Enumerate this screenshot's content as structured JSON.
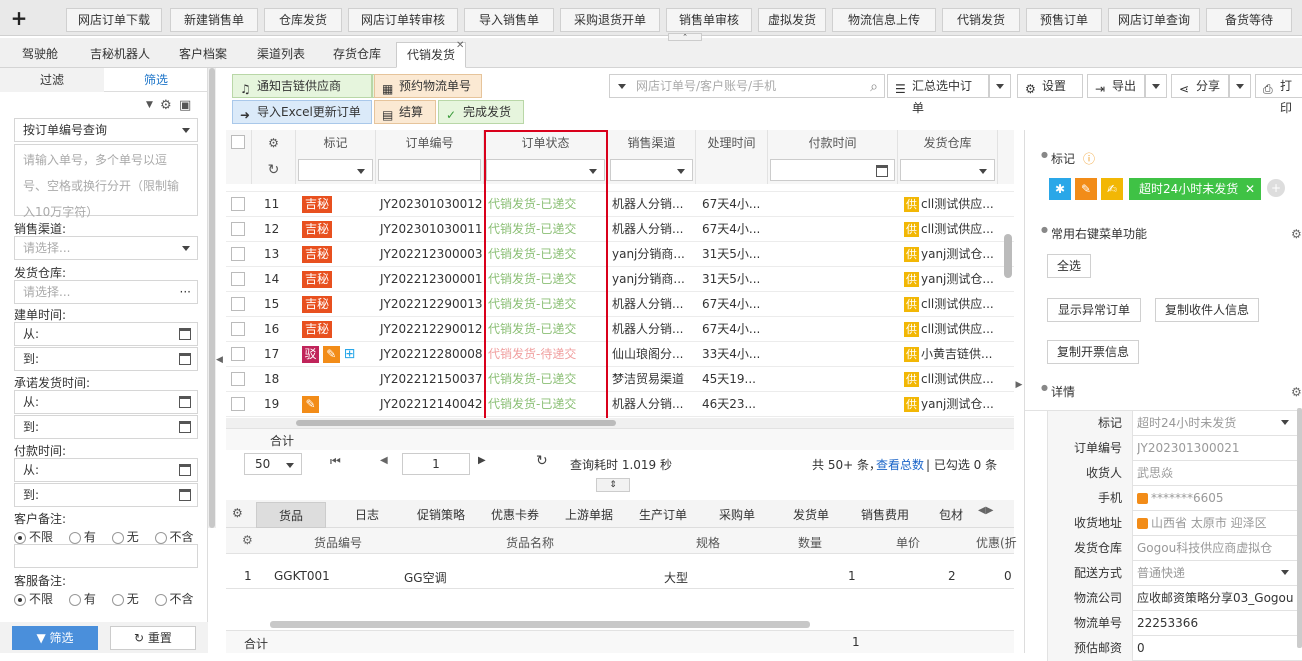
{
  "topnav": {
    "plus": "+",
    "tabs": [
      "网店订单下载",
      "新建销售单",
      "仓库发货",
      "网店订单转审核",
      "导入销售单",
      "采购退货开单",
      "销售单审核",
      "虚拟发货",
      "物流信息上传",
      "代销发货",
      "预售订单",
      "网店订单查询",
      "备货等待"
    ]
  },
  "pagetabs": [
    "驾驶舱",
    "吉秘机器人",
    "客户档案",
    "渠道列表",
    "存货仓库",
    "代销发货"
  ],
  "left": {
    "tab_filter": "过滤",
    "tab_screen": "筛选",
    "query_mode": "按订单编号查询",
    "order_input_ph": "请输入单号，多个单号以逗号、空格或换行分开（限制输入10万字符）",
    "sales_channel_label": "销售渠道:",
    "sales_channel_ph": "请选择...",
    "warehouse_label": "发货仓库:",
    "warehouse_ph": "请选择...",
    "created_label": "建单时间:",
    "from": "从:",
    "to": "到:",
    "promise_label": "承诺发货时间:",
    "pay_label": "付款时间:",
    "cust_note_label": "客户备注:",
    "svc_note_label": "客服备注:",
    "opt_any": "不限",
    "opt_has": "有",
    "opt_none": "无",
    "opt_not": "不含",
    "btn_filter": "筛选",
    "btn_reset": "重置"
  },
  "toolbar": {
    "notify": "通知吉链供应商",
    "reserve": "预约物流单号",
    "import_excel": "导入Excel更新订单",
    "settle": "结算",
    "done": "完成发货",
    "search_ph": "网店订单号/客户账号/手机",
    "summary": "汇总选中订单",
    "settings": "设置",
    "export": "导出",
    "share": "分享",
    "print": "打印"
  },
  "grid": {
    "headers": [
      "标记",
      "订单编号",
      "订单状态",
      "销售渠道",
      "处理时间",
      "付款时间",
      "发货仓库"
    ],
    "rows": [
      {
        "n": "11",
        "tag": "吉秘",
        "order": "JY202301030012",
        "status": "代销发货-已递交",
        "channel": "机器人分销...",
        "time": "67天4小...",
        "wh": "cll测试供应...",
        "gy": "供"
      },
      {
        "n": "12",
        "tag": "吉秘",
        "order": "JY202301030011",
        "status": "代销发货-已递交",
        "channel": "机器人分销...",
        "time": "67天4小...",
        "wh": "cll测试供应...",
        "gy": "供"
      },
      {
        "n": "13",
        "tag": "吉秘",
        "order": "JY202212300003",
        "status": "代销发货-已递交",
        "channel": "yanj分销商...",
        "time": "31天5小...",
        "wh": "yanj测试仓...",
        "gy": "供"
      },
      {
        "n": "14",
        "tag": "吉秘",
        "order": "JY202212300001",
        "status": "代销发货-已递交",
        "channel": "yanj分销商...",
        "time": "31天5小...",
        "wh": "yanj测试仓...",
        "gy": "供"
      },
      {
        "n": "15",
        "tag": "吉秘",
        "order": "JY202212290013",
        "status": "代销发货-已递交",
        "channel": "机器人分销...",
        "time": "67天4小...",
        "wh": "cll测试供应...",
        "gy": "供"
      },
      {
        "n": "16",
        "tag": "吉秘",
        "order": "JY202212290012",
        "status": "代销发货-已递交",
        "channel": "机器人分销...",
        "time": "67天4小...",
        "wh": "cll测试供应...",
        "gy": "供"
      },
      {
        "n": "17",
        "tag": "驳",
        "order": "JY202212280008",
        "status": "代销发货-待递交",
        "channel": "仙山琅阁分...",
        "time": "33天4小...",
        "wh": "小黄吉链供...",
        "gy": "供"
      },
      {
        "n": "18",
        "tag": "",
        "order": "JY202212150037",
        "status": "代销发货-已递交",
        "channel": "梦洁贸易渠道",
        "time": "45天19...",
        "wh": "cll测试供应...",
        "gy": "供"
      },
      {
        "n": "19",
        "tag": "wrench",
        "order": "JY202212140042",
        "status": "代销发货-已递交",
        "channel": "机器人分销...",
        "time": "46天23...",
        "wh": "yanj测试仓...",
        "gy": "供"
      }
    ],
    "total_label": "合计"
  },
  "pager": {
    "page_size": "50",
    "page": "1",
    "query_time": "查询耗时 1.019 秒",
    "total": "共 50+ 条，",
    "view_total": "查看总数",
    "selected": "| 已勾选 0 条"
  },
  "bottom": {
    "tabs": [
      "货品",
      "日志",
      "促销策略",
      "优惠卡券",
      "上游单据",
      "生产订单",
      "采购单",
      "发货单",
      "销售费用",
      "包材"
    ],
    "headers": [
      "货品编号",
      "货品名称",
      "规格",
      "数量",
      "单价",
      "优惠(折"
    ],
    "row": {
      "n": "1",
      "code": "GGKT001",
      "name": "GG空调",
      "spec": "大型",
      "qty": "1",
      "price": "2",
      "disc": "0"
    },
    "total_label": "合计",
    "total_qty": "1"
  },
  "right": {
    "mark_label": "标记",
    "mark_chip": "超时24小时未发货",
    "menu_label": "常用右键菜单功能",
    "btn_select_all": "全选",
    "btn_show_abnormal": "显示异常订单",
    "btn_copy_receiver": "复制收件人信息",
    "btn_copy_invoice": "复制开票信息",
    "detail_label": "详情",
    "details": [
      {
        "k": "标记",
        "v": "超时24小时未发货"
      },
      {
        "k": "订单编号",
        "v": "JY202301300021"
      },
      {
        "k": "收货人",
        "v": "武思焱"
      },
      {
        "k": "手机",
        "v": "*******6605"
      },
      {
        "k": "收货地址",
        "v": "山西省 太原市 迎泽区"
      },
      {
        "k": "发货仓库",
        "v": "Gogou科技供应商虚拟仓"
      },
      {
        "k": "配送方式",
        "v": "普通快递"
      },
      {
        "k": "物流公司",
        "v": "应收邮资策略分享03_Gogou"
      },
      {
        "k": "物流单号",
        "v": "22253366"
      },
      {
        "k": "预估邮资",
        "v": "0"
      }
    ]
  }
}
